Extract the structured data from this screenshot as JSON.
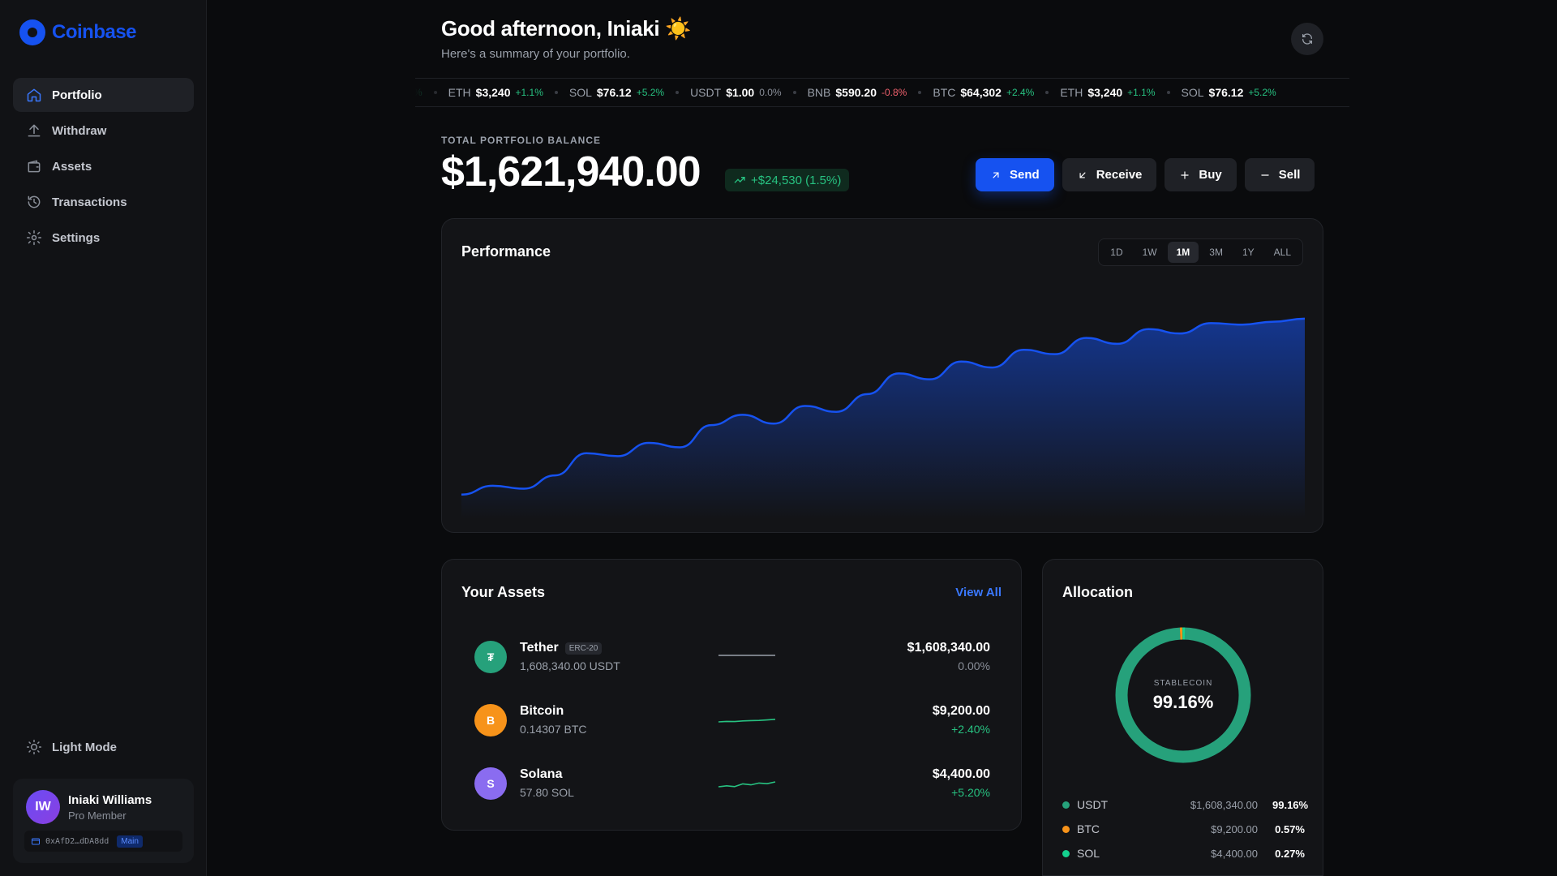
{
  "app": {
    "brand": "Coinbase",
    "brand_color": "#1652f0"
  },
  "sidebar": {
    "items": [
      {
        "label": "Portfolio",
        "icon": "home-icon",
        "active": true
      },
      {
        "label": "Withdraw",
        "icon": "upload-icon"
      },
      {
        "label": "Assets",
        "icon": "wallet-icon"
      },
      {
        "label": "Transactions",
        "icon": "history-icon"
      },
      {
        "label": "Settings",
        "icon": "gear-icon"
      }
    ],
    "theme_toggle": "Light Mode",
    "user": {
      "initials": "IW",
      "name": "Iniaki Williams",
      "tier": "Pro Member",
      "wallet_address": "0xAfD2…dDA8dd",
      "wallet_tag": "Main"
    }
  },
  "header": {
    "greeting": "Good afternoon, Iniaki ☀️",
    "subtitle": "Here's a summary of your portfolio."
  },
  "ticker": {
    "lead_fragment": "%",
    "items": [
      {
        "symbol": "ETH",
        "price": "$3,240",
        "change": "+1.1%",
        "dir": "up"
      },
      {
        "symbol": "SOL",
        "price": "$76.12",
        "change": "+5.2%",
        "dir": "up"
      },
      {
        "symbol": "USDT",
        "price": "$1.00",
        "change": "0.0%",
        "dir": "flat"
      },
      {
        "symbol": "BNB",
        "price": "$590.20",
        "change": "-0.8%",
        "dir": "down"
      },
      {
        "symbol": "BTC",
        "price": "$64,302",
        "change": "+2.4%",
        "dir": "up"
      },
      {
        "symbol": "ETH",
        "price": "$3,240",
        "change": "+1.1%",
        "dir": "up"
      },
      {
        "symbol": "SOL",
        "price": "$76.12",
        "change": "+5.2%",
        "dir": "up"
      }
    ]
  },
  "balance": {
    "label": "TOTAL PORTFOLIO BALANCE",
    "value": "$1,621,940.00",
    "change": "+$24,530 (1.5%)"
  },
  "actions": {
    "send": "Send",
    "receive": "Receive",
    "buy": "Buy",
    "sell": "Sell"
  },
  "performance": {
    "title": "Performance",
    "ranges": [
      "1D",
      "1W",
      "1M",
      "3M",
      "1Y",
      "ALL"
    ],
    "active_range": "1M",
    "line_color": "#1652f0"
  },
  "chart_data": {
    "type": "area",
    "title": "Performance",
    "xlabel": "",
    "ylabel": "",
    "grid": false,
    "values": [
      10,
      16,
      14,
      23,
      38,
      36,
      45,
      42,
      57,
      64,
      58,
      70,
      66,
      78,
      92,
      88,
      100,
      96,
      108,
      105,
      116,
      112,
      122,
      119,
      126,
      125,
      127,
      129
    ]
  },
  "assets": {
    "title": "Your Assets",
    "view_all": "View All",
    "rows": [
      {
        "initial": "₮",
        "name": "Tether",
        "tag": "ERC-20",
        "amount": "1,608,340.00 USDT",
        "value": "$1,608,340.00",
        "change": "0.00%",
        "dir": "flat",
        "color": "#26a17b",
        "spark_color": "#9aa0aa",
        "spark": [
          5,
          5,
          5,
          5,
          5,
          5,
          5,
          5
        ]
      },
      {
        "initial": "B",
        "name": "Bitcoin",
        "tag": "",
        "amount": "0.14307 BTC",
        "value": "$9,200.00",
        "change": "+2.40%",
        "dir": "up",
        "color": "#f7931a",
        "spark_color": "#27c281",
        "spark": [
          3,
          3.3,
          3.2,
          3.6,
          3.8,
          3.9,
          4.2,
          4.6
        ]
      },
      {
        "initial": "S",
        "name": "Solana",
        "tag": "",
        "amount": "57.80 SOL",
        "value": "$4,400.00",
        "change": "+5.20%",
        "dir": "up",
        "color": "#8a6cf0",
        "spark_color": "#27c281",
        "spark": [
          2,
          2.6,
          2.1,
          3.8,
          3.2,
          4.3,
          3.9,
          5
        ]
      }
    ]
  },
  "allocation": {
    "title": "Allocation",
    "center_label": "STABLECOIN",
    "center_value": "99.16%",
    "rows": [
      {
        "symbol": "USDT",
        "amount": "$1,608,340.00",
        "pct": "99.16%",
        "value": 99.16,
        "color": "#26a17b"
      },
      {
        "symbol": "BTC",
        "amount": "$9,200.00",
        "pct": "0.57%",
        "value": 0.57,
        "color": "#f7931a"
      },
      {
        "symbol": "SOL",
        "amount": "$4,400.00",
        "pct": "0.27%",
        "value": 0.27,
        "color": "#14d18f"
      }
    ]
  }
}
